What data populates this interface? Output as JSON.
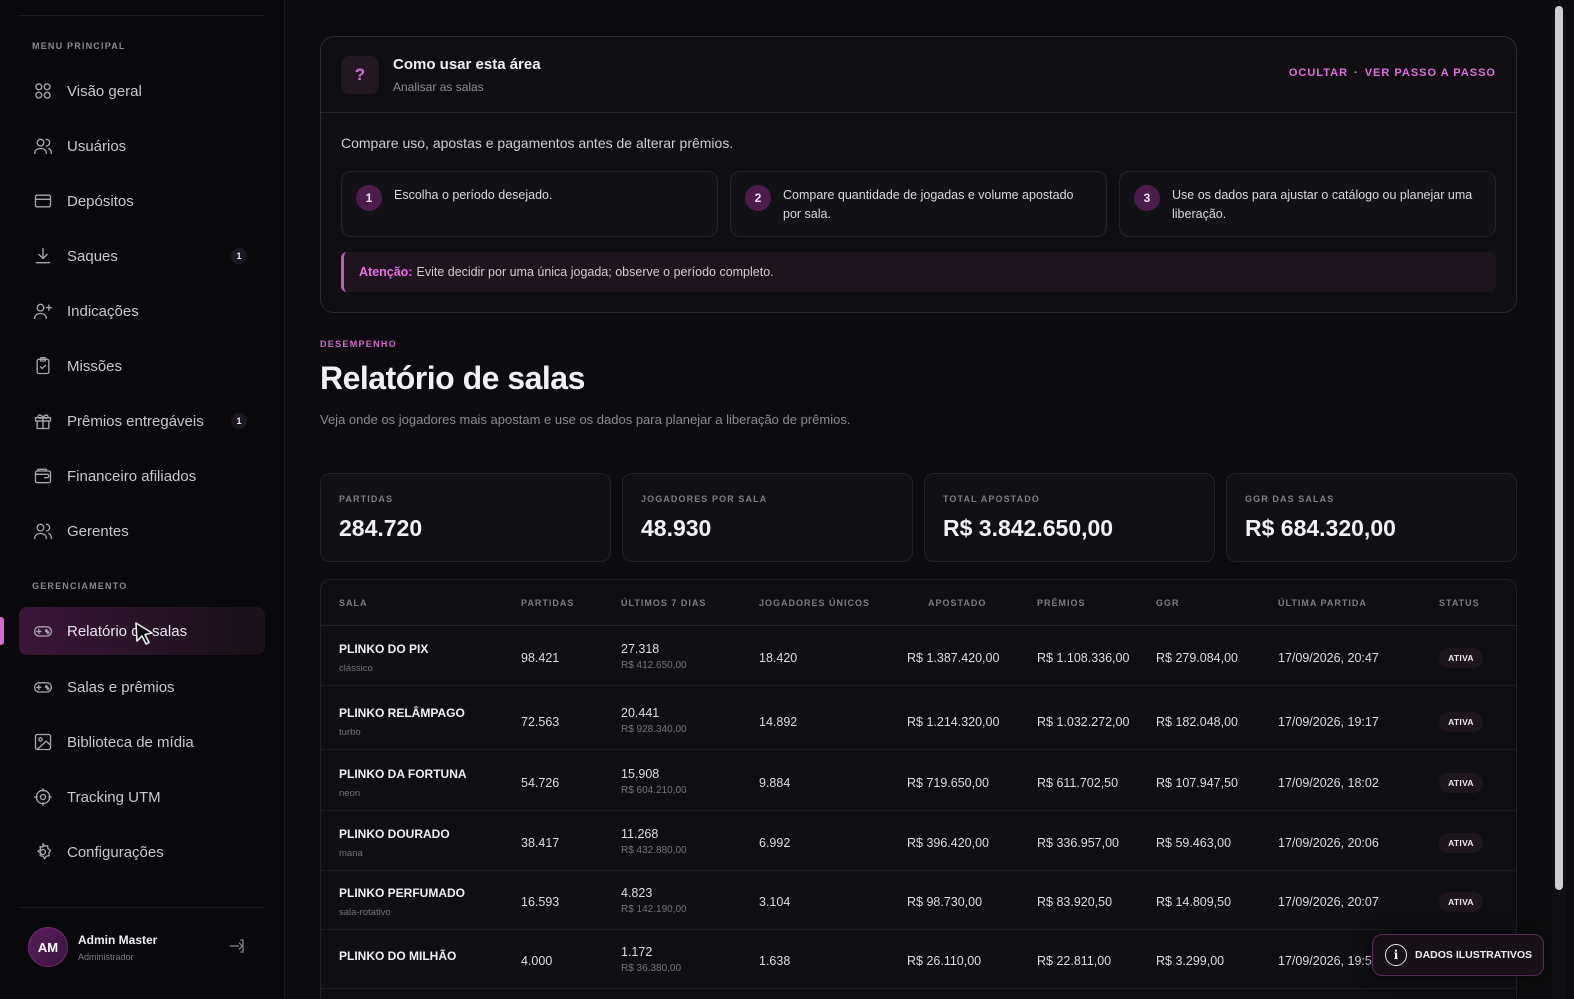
{
  "sidebar": {
    "section_main": "MENU PRINCIPAL",
    "section_manage": "GERENCIAMENTO",
    "items": [
      {
        "label": "Visão geral",
        "icon": "grid-icon"
      },
      {
        "label": "Usuários",
        "icon": "users-icon"
      },
      {
        "label": "Depósitos",
        "icon": "card-icon"
      },
      {
        "label": "Saques",
        "icon": "download-icon",
        "badge": "1"
      },
      {
        "label": "Indicações",
        "icon": "user-plus-icon"
      },
      {
        "label": "Missões",
        "icon": "clipboard-icon"
      },
      {
        "label": "Prêmios entregáveis",
        "icon": "gift-icon",
        "badge": "1"
      },
      {
        "label": "Financeiro afiliados",
        "icon": "wallet-icon"
      },
      {
        "label": "Gerentes",
        "icon": "users-icon"
      }
    ],
    "manage_items": [
      {
        "label": "Relatório de salas",
        "icon": "gamepad-icon",
        "active": true
      },
      {
        "label": "Salas e prêmios",
        "icon": "gamepad-icon"
      },
      {
        "label": "Biblioteca de mídia",
        "icon": "image-icon"
      },
      {
        "label": "Tracking UTM",
        "icon": "target-icon"
      },
      {
        "label": "Configurações",
        "icon": "gear-icon"
      }
    ],
    "user": {
      "initials": "AM",
      "name": "Admin Master",
      "role": "Administrador"
    }
  },
  "help": {
    "icon": "?",
    "title": "Como usar esta área",
    "subtitle": "Analisar as salas",
    "action_hide": "OCULTAR",
    "action_sep": "·",
    "action_steps": "VER PASSO A PASSO",
    "intro": "Compare uso, apostas e pagamentos antes de alterar prêmios.",
    "steps": [
      {
        "num": "1",
        "text": "Escolha o período desejado."
      },
      {
        "num": "2",
        "text": "Compare quantidade de jogadas e volume apostado por sala."
      },
      {
        "num": "3",
        "text": "Use os dados para ajustar o catálogo ou planejar uma liberação."
      }
    ],
    "warning_label": "Atenção:",
    "warning_text": "Evite decidir por uma única jogada; observe o período completo."
  },
  "page": {
    "eyebrow": "DESEMPENHO",
    "title": "Relatório de salas",
    "description": "Veja onde os jogadores mais apostam e use os dados para planejar a liberação de prêmios."
  },
  "kpis": [
    {
      "label": "PARTIDAS",
      "value": "284.720"
    },
    {
      "label": "JOGADORES POR SALA",
      "value": "48.930"
    },
    {
      "label": "TOTAL APOSTADO",
      "value": "R$ 3.842.650,00"
    },
    {
      "label": "GGR DAS SALAS",
      "value": "R$ 684.320,00"
    }
  ],
  "table": {
    "headers": [
      "SALA",
      "PARTIDAS",
      "ÚLTIMOS 7 DIAS",
      "JOGADORES ÚNICOS",
      "APOSTADO",
      "PRÊMIOS",
      "GGR",
      "ÚLTIMA PARTIDA",
      "STATUS"
    ],
    "rows": [
      {
        "name": "PLINKO DO PIX",
        "mode": "clássico",
        "partidas": "98.421",
        "last7": "27.318",
        "last7_amount": "R$ 412.650,00",
        "players": "18.420",
        "bet": "R$ 1.387.420,00",
        "prizes": "R$ 1.108.336,00",
        "ggr": "R$ 279.084,00",
        "last": "17/09/2026, 20:47",
        "status": "ATIVA"
      },
      {
        "name": "PLINKO RELÂMPAGO",
        "mode": "turbo",
        "partidas": "72.563",
        "last7": "20.441",
        "last7_amount": "R$ 928.340,00",
        "players": "14.892",
        "bet": "R$ 1.214.320,00",
        "prizes": "R$ 1.032.272,00",
        "ggr": "R$ 182.048,00",
        "last": "17/09/2026, 19:17",
        "status": "ATIVA"
      },
      {
        "name": "PLINKO DA FORTUNA",
        "mode": "neon",
        "partidas": "54.726",
        "last7": "15.908",
        "last7_amount": "R$ 604.210,00",
        "players": "9.884",
        "bet": "R$ 719.650,00",
        "prizes": "R$ 611.702,50",
        "ggr": "R$ 107.947,50",
        "last": "17/09/2026, 18:02",
        "status": "ATIVA"
      },
      {
        "name": "PLINKO DOURADO",
        "mode": "mana",
        "partidas": "38.417",
        "last7": "11.268",
        "last7_amount": "R$ 432.880,00",
        "players": "6.992",
        "bet": "R$ 396.420,00",
        "prizes": "R$ 336.957,00",
        "ggr": "R$ 59.463,00",
        "last": "17/09/2026, 20:06",
        "status": "ATIVA"
      },
      {
        "name": "PLINKO PERFUMADO",
        "mode": "sala-rotativo",
        "partidas": "16.593",
        "last7": "4.823",
        "last7_amount": "R$ 142.190,00",
        "players": "3.104",
        "bet": "R$ 98.730,00",
        "prizes": "R$ 83.920,50",
        "ggr": "R$ 14.809,50",
        "last": "17/09/2026, 20:07",
        "status": "ATIVA"
      },
      {
        "name": "PLINKO DO MILHÃO",
        "mode": "",
        "partidas": "4.000",
        "last7": "1.172",
        "last7_amount": "R$ 36.380,00",
        "players": "1.638",
        "bet": "R$ 26.110,00",
        "prizes": "R$ 22.811,00",
        "ggr": "R$ 3.299,00",
        "last": "17/09/2026, 19:51",
        "status": ""
      }
    ]
  },
  "floating": {
    "label": "DADOS ILUSTRATIVOS",
    "icon": "info-icon"
  },
  "colors": {
    "accent": "#d46ad2",
    "background": "#0c0c0e"
  }
}
